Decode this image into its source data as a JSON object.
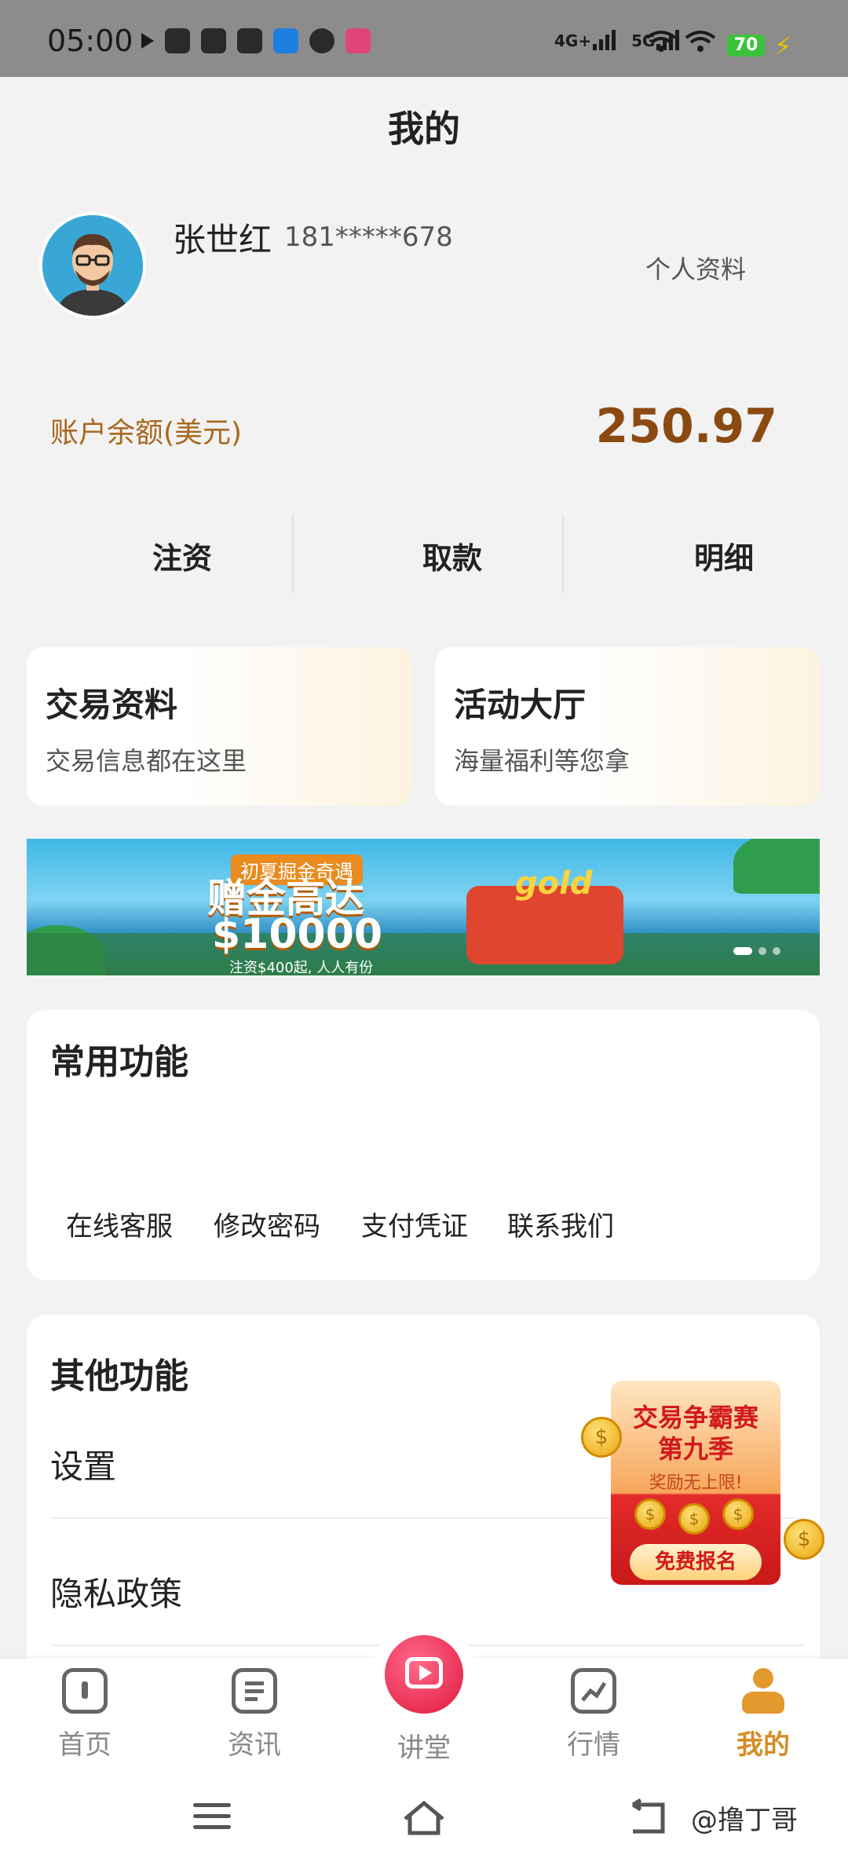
{
  "status_bar": {
    "time": "05:00",
    "network1": "4G+",
    "network2": "5G",
    "battery": "70"
  },
  "header": {
    "title": "我的"
  },
  "profile": {
    "name": "张世红",
    "phone": "181*****678",
    "profile_link": "个人资料"
  },
  "balance": {
    "label": "账户余额(美元)",
    "value": "250.97"
  },
  "actions": [
    "注资",
    "取款",
    "明细"
  ],
  "cards": [
    {
      "title": "交易资料",
      "subtitle": "交易信息都在这里"
    },
    {
      "title": "活动大厅",
      "subtitle": "海量福利等您拿"
    }
  ],
  "banner": {
    "tag": "初夏掘金奇遇",
    "headline": "赠金高达",
    "amount": "$10000",
    "footnote": "注资$400起, 人人有份",
    "logo": "gold"
  },
  "common_functions": {
    "title": "常用功能",
    "items": [
      "在线客服",
      "修改密码",
      "支付凭证",
      "联系我们"
    ]
  },
  "other_functions": {
    "title": "其他功能",
    "items": [
      "设置",
      "隐私政策"
    ]
  },
  "promo": {
    "line1": "交易争霸赛",
    "line2": "第九季",
    "line3": "奖励无上限!",
    "button": "免费报名"
  },
  "tabs": [
    {
      "label": "首页",
      "icon": "home-icon"
    },
    {
      "label": "资讯",
      "icon": "news-icon"
    },
    {
      "label": "讲堂",
      "icon": "tv-play-icon"
    },
    {
      "label": "行情",
      "icon": "market-chart-icon"
    },
    {
      "label": "我的",
      "icon": "person-icon",
      "active": true
    }
  ],
  "watermark": "@撸丁哥",
  "colors": {
    "accent": "#d48e26",
    "balance": "#8b4a12",
    "tab_center": "#e0173e"
  }
}
